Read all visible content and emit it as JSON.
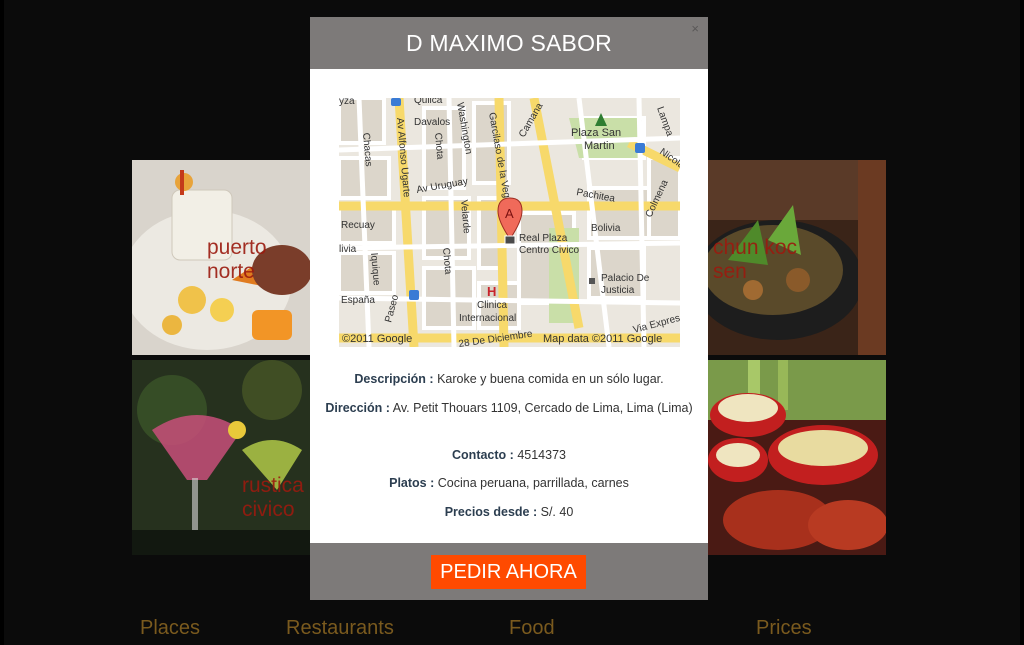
{
  "tiles": [
    {
      "label": "puerto norte"
    },
    {
      "label": "chun koc sen"
    },
    {
      "label": "rustica civico"
    }
  ],
  "nav": [
    "Places",
    "Restaurants",
    "Food",
    "Prices"
  ],
  "modal": {
    "title": "D MAXIMO SABOR",
    "close": "×",
    "map": {
      "marker_letter": "A",
      "copyright_left": "©2011 Google",
      "copyright_right": "Map data ©2011 Google",
      "streets": [
        "yza",
        "Quilca",
        "Davalos",
        "Washington",
        "Garcilaso de la Vega",
        "Camana",
        "Plaza San Martin",
        "Lampa",
        "Nicolas",
        "Chacas",
        "Av Alfonso Ugarte",
        "Chota",
        "Av Uruguay",
        "Velarde",
        "Pachitea",
        "Recuay",
        "Bolivia",
        "Colmena",
        "Real Plaza Centro Civico",
        "livia",
        "Iquique",
        "Chota",
        "Palacio De Justicia",
        "España",
        "Clinica Internacional",
        "H",
        "Paseo",
        "28 De Diciembre",
        "Via Expresa"
      ]
    },
    "fields": [
      {
        "label": "Descripción :",
        "value": "Karoke y buena comida en un sólo lugar."
      },
      {
        "label": "Dirección :",
        "value": "Av. Petit Thouars 1109, Cercado de Lima, Lima (Lima)"
      },
      {
        "label": "Contacto :",
        "value": "4514373"
      },
      {
        "label": "Platos :",
        "value": "Cocina peruana, parrillada, carnes"
      },
      {
        "label": "Precios desde :",
        "value": "S/. 40"
      }
    ],
    "order_button": "PEDIR AHORA"
  },
  "colors": {
    "modal_header": "#7d7a79",
    "order_button": "#ff4a00",
    "tile_label": "#9b1a0f",
    "nav_text": "#7a5a1e"
  }
}
